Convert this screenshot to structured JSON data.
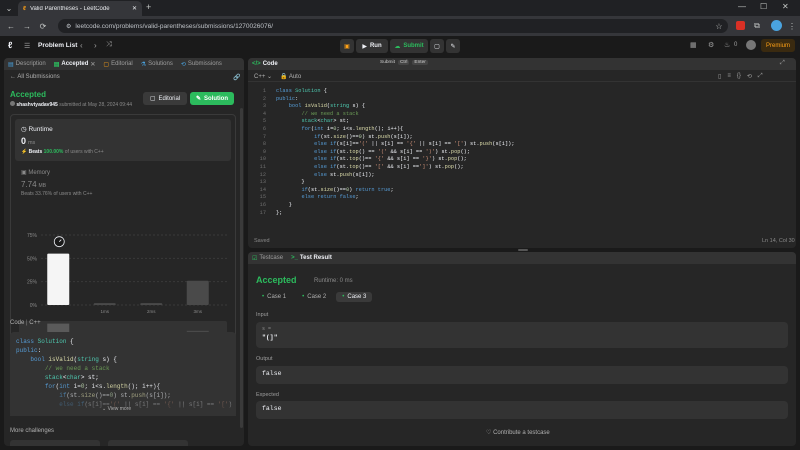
{
  "browser": {
    "tab_title": "Valid Parentheses - LeetCode",
    "url": "leetcode.com/problems/valid-parentheses/submissions/1270026076/"
  },
  "nav": {
    "problem_list": "Problem List",
    "run": "Run",
    "submit": "Submit",
    "streak": "0",
    "premium": "Premium"
  },
  "left": {
    "tabs": [
      "Description",
      "Accepted",
      "Editorial",
      "Solutions",
      "Submissions"
    ],
    "back": "All Submissions",
    "status": "Accepted",
    "user": "shashvtyadav945",
    "submitted_at": "submitted at May 28, 2024 09:44",
    "editorial_btn": "Editorial",
    "solution_btn": "Solution",
    "runtime": {
      "label": "Runtime",
      "value": "0",
      "unit": "ms",
      "beats_label": "Beats",
      "beats": "100.00%",
      "beats_suffix": "of users with C++"
    },
    "memory": {
      "label": "Memory",
      "value": "7.74",
      "unit": "MB",
      "beats": "Beats 33.76% of users with C++"
    },
    "code_label": "Code",
    "code_lang": "C++",
    "code_preview": [
      "class Solution {",
      "public:",
      "    bool isValid(string s) {",
      "        // we need a stack",
      "        stack<char> st;",
      "        for(int i=0; i<s.length(); i++){",
      "            if(st.size()==0) st.push(s[i]);",
      "            else if(s[i]=='(' || s[i] == '{' || s[i] == '[') st."
    ],
    "view_more": "View more",
    "more_challenges": "More challenges"
  },
  "chart_data": {
    "type": "bar",
    "y_ticks": [
      "75%",
      "50%",
      "25%",
      "0%"
    ],
    "ylim": [
      0,
      75
    ],
    "bars": [
      {
        "label": "",
        "value": 55,
        "highlight": true
      },
      {
        "label": "1ms",
        "value": 2,
        "highlight": false
      },
      {
        "label": "2ms",
        "value": 2,
        "highlight": false
      },
      {
        "label": "3ms",
        "value": 26,
        "highlight": false
      }
    ],
    "nav_labels": [
      "1ms",
      "2ms",
      "3ms"
    ]
  },
  "editor": {
    "title": "Code",
    "shortcut": [
      "Submit",
      "Ctrl",
      "Enter"
    ],
    "lang": "C++",
    "auto": "Auto",
    "saved": "Saved",
    "cursor": "Ln 14, Col 30"
  },
  "code": [
    "class Solution {",
    "public:",
    "    bool isValid(string s) {",
    "        // we need a stack",
    "        stack<char> st;",
    "        for(int i=0; i<s.length(); i++){",
    "            if(st.size()==0) st.push(s[i]);",
    "            else if(s[i]=='(' || s[i] == '{' || s[i] == '[') st.push(s[i]);",
    "            else if(st.top() == '(' && s[i] == ')') st.pop();",
    "            else if(st.top()== '{' && s[i] == '}') st.pop();",
    "            else if(st.top()== '[' && s[i] ==']') st.pop();",
    "            else st.push(s[i]);",
    "        }",
    "        if(st.size()==0) return true;",
    "        else return false;",
    "    }",
    "};"
  ],
  "tests": {
    "tab_testcase": "Testcase",
    "tab_result": "Test Result",
    "status": "Accepted",
    "runtime": "Runtime: 0 ms",
    "cases": [
      "Case 1",
      "Case 2",
      "Case 3"
    ],
    "input_label": "Input",
    "input_var": "s =",
    "input_value": "\"(]\"",
    "output_label": "Output",
    "output_value": "false",
    "expected_label": "Expected",
    "expected_value": "false",
    "contribute": "Contribute a testcase"
  },
  "colors": {
    "accent_green": "#2cbb5d",
    "premium": "#ffa116",
    "background": "#1a1a1a",
    "panel": "#262626"
  }
}
